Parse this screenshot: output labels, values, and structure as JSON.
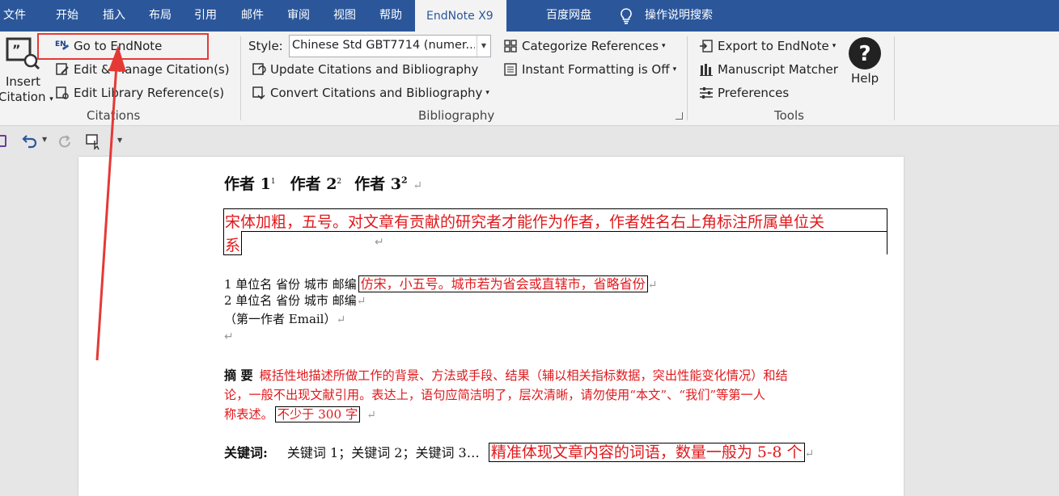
{
  "tabs": {
    "file": "文件",
    "home": "开始",
    "insert": "插入",
    "layout": "布局",
    "references": "引用",
    "mailings": "邮件",
    "review": "审阅",
    "view": "视图",
    "help": "帮助",
    "endnote": "EndNote X9",
    "baidu": "百度网盘",
    "tell_me": "操作说明搜索"
  },
  "ribbon": {
    "citations": {
      "insert_line1": "Insert",
      "insert_line2": "Citation",
      "go_to_endnote": "Go to EndNote",
      "edit_manage": "Edit & Manage Citation(s)",
      "edit_library": "Edit Library Reference(s)",
      "group_label": "Citations"
    },
    "bibliography": {
      "style_label": "Style:",
      "style_value": "Chinese Std GBT7714 (numer...",
      "update": "Update Citations and Bibliography",
      "convert": "Convert Citations and Bibliography",
      "categorize": "Categorize References",
      "instant_formatting": "Instant Formatting is Off",
      "group_label": "Bibliography"
    },
    "tools": {
      "export": "Export to EndNote",
      "manuscript": "Manuscript Matcher",
      "preferences": "Preferences",
      "help": "Help",
      "group_label": "Tools"
    }
  },
  "document": {
    "authors": [
      "作者 1",
      "作者 2",
      "作者 3"
    ],
    "author_sups": [
      "1",
      "2",
      "2"
    ],
    "author_note_line1": "宋体加粗，五号。对文章有贡献的研究者才能作为作者，作者姓名右上角标注所属单位关",
    "author_note_line2": "系",
    "affil1": "1 单位名 省份 城市 邮编",
    "affil_note": "仿宋，小五号。城市若为省会或直辖市，省略省份",
    "affil2": "2 单位名 省份 城市 邮编",
    "email": "（第一作者 Email）",
    "abstract_label": "摘 要",
    "abstract_line1": "概括性地描述所做工作的背景、方法或手段、结果（辅以相关指标数据，突出性能变化情况）和结",
    "abstract_line2": "论，一般不出现文献引用。表达上，语句应简洁明了，层次清晰，请勿使用“本文”、“我们”等第一人",
    "abstract_line3": "称表述。",
    "abstract_box": "不少于 300 字",
    "keywords_label": "关键词:",
    "keywords": "关键词 1；关键词 2；关键词 3…",
    "keywords_note": "精准体现文章内容的词语，数量一般为 5-8 个",
    "return_mark": "↵"
  },
  "colors": {
    "tabbar": "#2b579a",
    "ribbon": "#f3f3f3",
    "annotation_red": "#e0191c",
    "highlight_box": "#e53935"
  }
}
